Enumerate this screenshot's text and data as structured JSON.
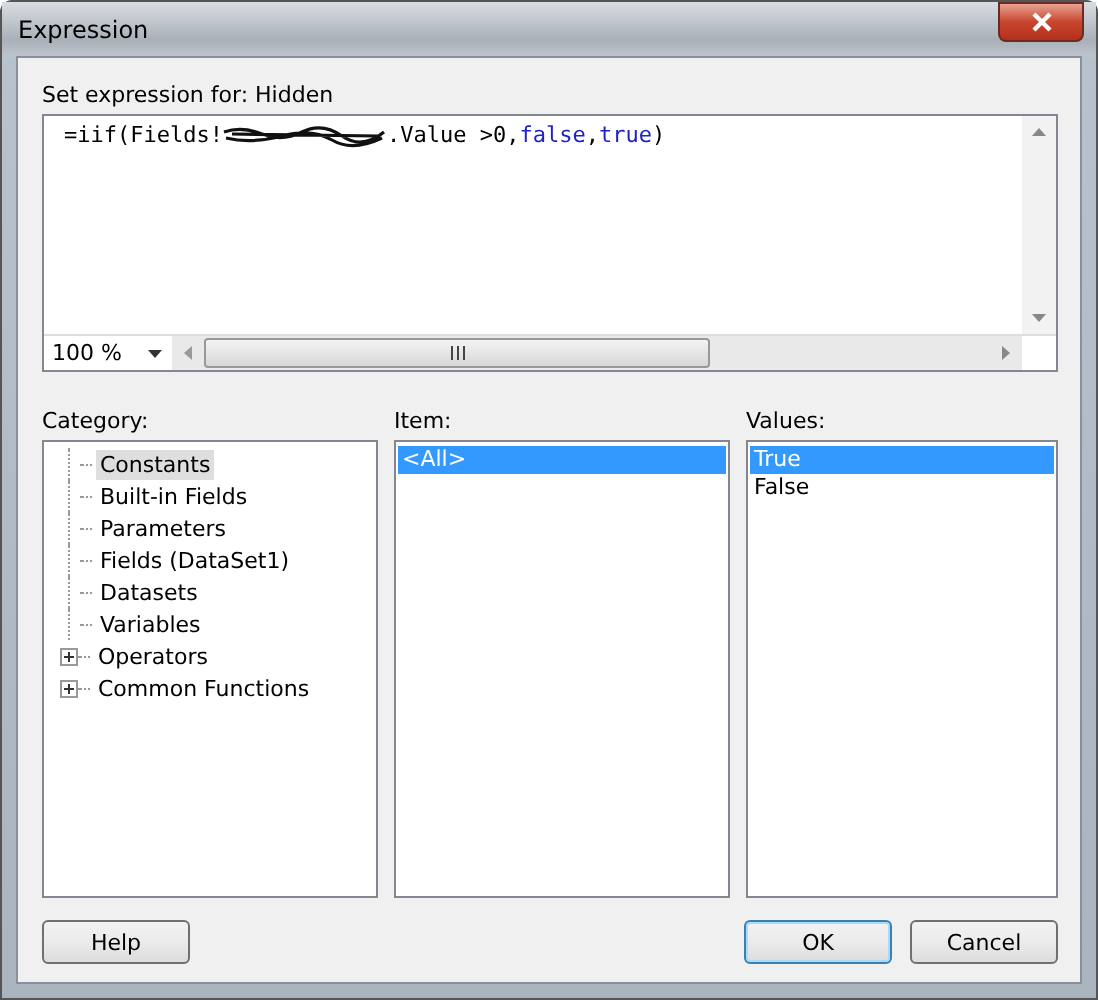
{
  "window": {
    "title": "Expression"
  },
  "expression": {
    "label": "Set expression for: Hidden",
    "segments": [
      {
        "kind": "text",
        "text": "=iif(Fields!"
      },
      {
        "kind": "redacted"
      },
      {
        "kind": "text",
        "text": ".Value >0,"
      },
      {
        "kind": "keyword",
        "text": "false"
      },
      {
        "kind": "text",
        "text": ","
      },
      {
        "kind": "keyword",
        "text": "true"
      },
      {
        "kind": "text",
        "text": ")"
      }
    ],
    "zoom": "100 %"
  },
  "category": {
    "label": "Category:",
    "items": [
      {
        "label": "Constants",
        "selected": true
      },
      {
        "label": "Built-in Fields",
        "selected": false
      },
      {
        "label": "Parameters",
        "selected": false
      },
      {
        "label": "Fields (DataSet1)",
        "selected": false
      },
      {
        "label": "Datasets",
        "selected": false
      },
      {
        "label": "Variables",
        "selected": false
      },
      {
        "label": "Operators",
        "selected": false,
        "expanded": false
      },
      {
        "label": "Common Functions",
        "selected": false,
        "expanded": false
      }
    ]
  },
  "item": {
    "label": "Item:",
    "items": [
      {
        "label": "<All>",
        "selected": true
      }
    ]
  },
  "values": {
    "label": "Values:",
    "items": [
      {
        "label": "True",
        "selected": true
      },
      {
        "label": "False",
        "selected": false
      }
    ]
  },
  "buttons": [
    {
      "label": "Help",
      "default": false
    },
    {
      "label": "OK",
      "default": true
    },
    {
      "label": "Cancel",
      "default": false
    }
  ]
}
